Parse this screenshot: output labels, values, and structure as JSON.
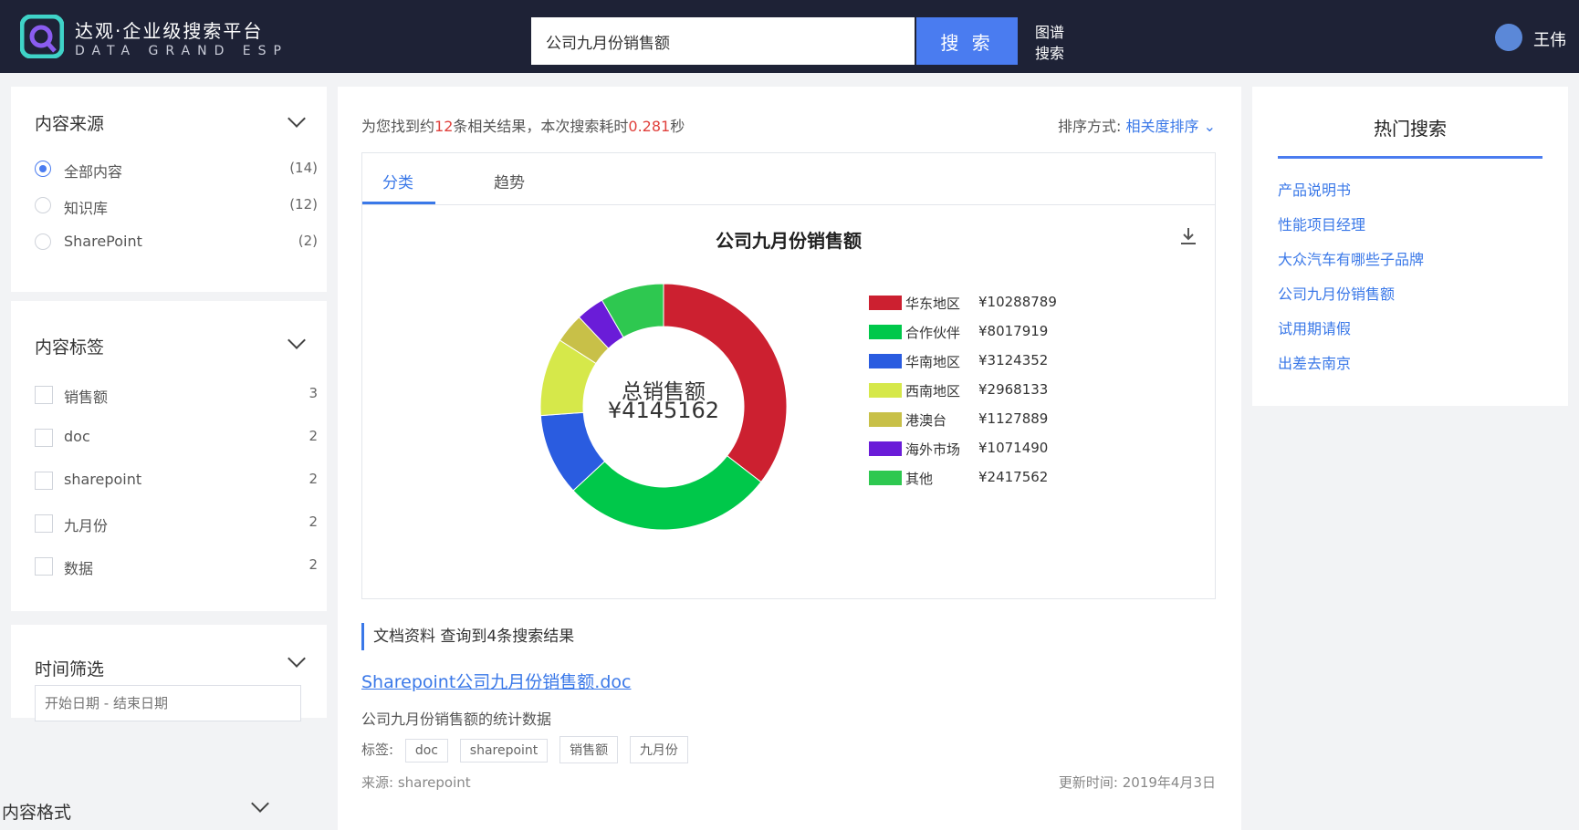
{
  "header": {
    "logo_cn": "达观·企业级搜索平台",
    "logo_en": "DATA GRAND ESP",
    "search_value": "公司九月份销售额",
    "search_button": "搜 索",
    "graph_search": "图谱搜索",
    "user_name": "王伟"
  },
  "filters": {
    "source": {
      "title": "内容来源",
      "items": [
        {
          "label": "全部内容",
          "count": "(14)",
          "selected": true
        },
        {
          "label": "知识库",
          "count": "(12)",
          "selected": false
        },
        {
          "label": "SharePoint",
          "count": "(2)",
          "selected": false
        }
      ]
    },
    "tags": {
      "title": "内容标签",
      "items": [
        {
          "label": "销售额",
          "count": "3"
        },
        {
          "label": "doc",
          "count": "2"
        },
        {
          "label": "sharepoint",
          "count": "2"
        },
        {
          "label": "九月份",
          "count": "2"
        },
        {
          "label": "数据",
          "count": "2"
        }
      ]
    },
    "time": {
      "title": "时间筛选",
      "placeholder": "开始日期 - 结束日期"
    },
    "format": {
      "title": "内容格式"
    }
  },
  "results": {
    "summary_prefix": "为您找到约",
    "count": "12",
    "summary_mid": "条相关结果，本次搜索耗时",
    "time": "0.281",
    "summary_suffix": "秒",
    "sort_label": "排序方式:",
    "sort_value": "相关度排序"
  },
  "tabs": [
    "分类",
    "趋势"
  ],
  "chart_data": {
    "type": "pie",
    "title": "公司九月份销售额",
    "center_label": "总销售额",
    "center_value": "¥4145162",
    "series": [
      {
        "name": "华东地区",
        "label": "¥10288789",
        "value": 10288789,
        "color": "#cc2030"
      },
      {
        "name": "合作伙伴",
        "label": "¥8017919",
        "value": 8017919,
        "color": "#00c84a"
      },
      {
        "name": "华南地区",
        "label": "¥3124352",
        "value": 3124352,
        "color": "#2a5ce0"
      },
      {
        "name": "西南地区",
        "label": "¥2968133",
        "value": 2968133,
        "color": "#d6e84a"
      },
      {
        "name": "港澳台",
        "label": "¥1127889",
        "value": 1127889,
        "color": "#c8c048"
      },
      {
        "name": "海外市场",
        "label": "¥1071490",
        "value": 1071490,
        "color": "#6a1cd8"
      },
      {
        "name": "其他",
        "label": "¥2417562",
        "value": 2417562,
        "color": "#2ec850"
      }
    ]
  },
  "doc_section": {
    "heading": "文档资料 查询到4条搜索结果",
    "title": "Sharepoint公司九月份销售额.doc",
    "description": "公司九月份销售额的统计数据",
    "tags_label": "标签:",
    "tags": [
      "doc",
      "sharepoint",
      "销售额",
      "九月份"
    ],
    "source": "来源: sharepoint",
    "date": "更新时间: 2019年4月3日"
  },
  "hot_search": {
    "title": "热门搜索",
    "items": [
      "产品说明书",
      "性能项目经理",
      "大众汽车有哪些子品牌",
      "公司九月份销售额",
      "试用期请假",
      "出差去南京"
    ]
  }
}
